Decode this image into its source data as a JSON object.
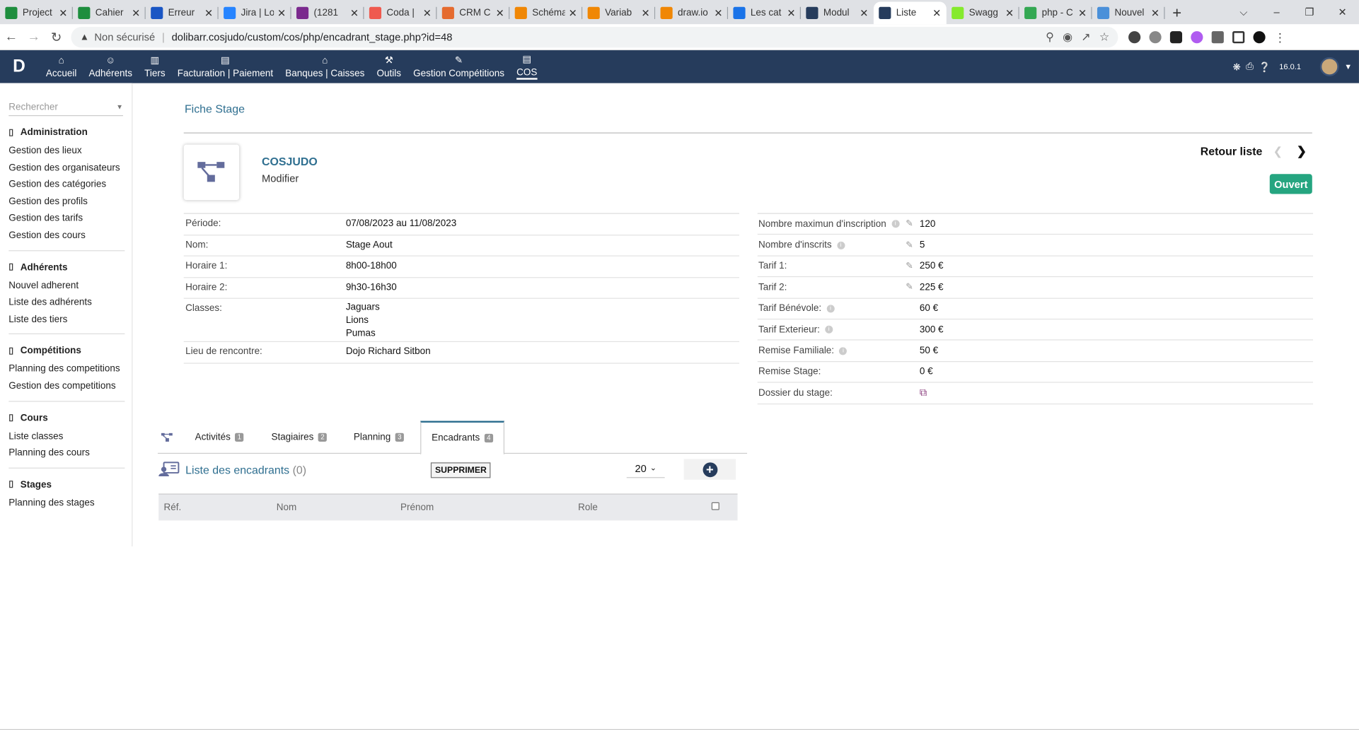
{
  "browser": {
    "tabs": [
      {
        "title": "Project",
        "color": "#1e8e3e"
      },
      {
        "title": "Cahier",
        "color": "#1e8e3e"
      },
      {
        "title": "Erreur",
        "color": "#1a56c4"
      },
      {
        "title": "Jira | Lo",
        "color": "#2684ff"
      },
      {
        "title": "(1281",
        "color": "#7b2a8e"
      },
      {
        "title": "Coda |",
        "color": "#ef5a4f"
      },
      {
        "title": "CRM C",
        "color": "#e56b2f"
      },
      {
        "title": "Schéma",
        "color": "#f08705"
      },
      {
        "title": "Variab",
        "color": "#f08705"
      },
      {
        "title": "draw.io",
        "color": "#f08705"
      },
      {
        "title": "Les cat",
        "color": "#1a73e8"
      },
      {
        "title": "Modul",
        "color": "#263c5c"
      },
      {
        "title": "Liste",
        "color": "#263c5c"
      },
      {
        "title": "Swagg",
        "color": "#85ea2d"
      },
      {
        "title": "php - C",
        "color": "#34a853"
      },
      {
        "title": "Nouvel",
        "color": "#4a90d9"
      }
    ],
    "active_tab_index": 12,
    "new_tab": "+",
    "insecure_label": "Non sécurisé",
    "url": "dolibarr.cosjudo/custom/cos/php/encadrant_stage.php?id=48"
  },
  "topmenu": {
    "logo": "D",
    "items": [
      {
        "label": "Accueil",
        "icon": "home-icon"
      },
      {
        "label": "Adhérents",
        "icon": "user-icon"
      },
      {
        "label": "Tiers",
        "icon": "building-icon"
      },
      {
        "label": "Facturation | Paiement",
        "icon": "money-icon"
      },
      {
        "label": "Banques | Caisses",
        "icon": "bank-icon"
      },
      {
        "label": "Outils",
        "icon": "wrench-icon"
      },
      {
        "label": "Gestion Compétitions",
        "icon": "edit-icon"
      },
      {
        "label": "COS",
        "icon": "document-icon"
      }
    ],
    "active_index": 7,
    "version": "16.0.1"
  },
  "sidebar": {
    "search_placeholder": "Rechercher",
    "sections": [
      {
        "title": "Administration",
        "items": [
          "Gestion des lieux",
          "Gestion des organisateurs",
          "Gestion des catégories",
          "Gestion des profils",
          "Gestion des tarifs",
          "Gestion des cours"
        ]
      },
      {
        "title": "Adhérents",
        "items": [
          "Nouvel adherent",
          "Liste des adhérents",
          "Liste des tiers"
        ]
      },
      {
        "title": "Compétitions",
        "items": [
          "Planning des competitions",
          "Gestion des competitions"
        ]
      },
      {
        "title": "Cours",
        "items": [
          "Liste classes",
          "Planning des cours"
        ]
      },
      {
        "title": "Stages",
        "items": [
          "Planning des stages"
        ]
      }
    ]
  },
  "card": {
    "tab_title": "Fiche Stage",
    "ref": "COSJUDO",
    "sub": "Modifier",
    "back_link": "Retour liste",
    "status": "Ouvert",
    "status_color": "#25a580"
  },
  "left_fields": [
    {
      "label": "Période:",
      "value": "07/08/2023 au 11/08/2023"
    },
    {
      "label": "Nom:",
      "value": "Stage Aout"
    },
    {
      "label": "Horaire 1:",
      "value": "8h00-18h00"
    },
    {
      "label": "Horaire 2:",
      "value": "9h30-16h30"
    },
    {
      "label": "Classes:",
      "values": [
        "Jaguars",
        "Lions",
        "Pumas"
      ]
    },
    {
      "label": "Lieu de rencontre:",
      "value": "Dojo Richard Sitbon"
    }
  ],
  "right_fields": [
    {
      "label": "Nombre maximun d'inscription",
      "info": true,
      "editable": true,
      "value": "120"
    },
    {
      "label": "Nombre d'inscrits",
      "info": true,
      "editable": true,
      "value": "5"
    },
    {
      "label": "Tarif 1:",
      "info": false,
      "editable": true,
      "value": "250 €"
    },
    {
      "label": "Tarif 2:",
      "info": false,
      "editable": true,
      "value": "225 €"
    },
    {
      "label": "Tarif Bénévole:",
      "info": true,
      "editable": false,
      "value": "60 €"
    },
    {
      "label": "Tarif Exterieur:",
      "info": true,
      "editable": false,
      "value": "300 €"
    },
    {
      "label": "Remise Familiale:",
      "info": true,
      "editable": false,
      "value": "50 €"
    },
    {
      "label": "Remise Stage:",
      "info": false,
      "editable": false,
      "value": "0 €"
    },
    {
      "label": "Dossier du stage:",
      "info": false,
      "editable": false,
      "value": ""
    }
  ],
  "tabs": [
    {
      "label": "Activités",
      "count": "1"
    },
    {
      "label": "Stagiaires",
      "count": "2"
    },
    {
      "label": "Planning",
      "count": "3"
    },
    {
      "label": "Encadrants",
      "count": "4"
    }
  ],
  "active_tab": 3,
  "list": {
    "title": "Liste des encadrants",
    "count": "(0)",
    "delete_label": "SUPPRIMER",
    "limit": "20",
    "columns": [
      "Réf.",
      "Nom",
      "Prénom",
      "Role"
    ]
  }
}
